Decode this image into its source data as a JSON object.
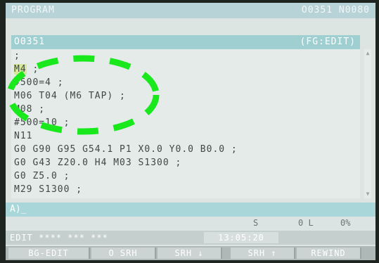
{
  "title_bar": {
    "mode": "PROGRAM",
    "program_info": "O0351 N0080"
  },
  "program_header": {
    "program_number": "O0351",
    "mode_tag": "(FG:EDIT)"
  },
  "program_lines": [
    {
      "first": ";",
      "rest": ""
    },
    {
      "first": "M4",
      "rest": " ;"
    },
    {
      "first": "#500=4",
      "rest": " ;"
    },
    {
      "first": "M06",
      "rest": " T04 (M6 TAP) ;"
    },
    {
      "first": "M08",
      "rest": " ;"
    },
    {
      "first": "#500=10",
      "rest": " ;"
    },
    {
      "first": "N11",
      "rest": ""
    },
    {
      "first": "G0",
      "rest": " G90 G95 G54.1 P1 X0.0 Y0.0 B0.0 ;"
    },
    {
      "first": "G0",
      "rest": " G43 Z20.0 H4 M03 S1300 ;"
    },
    {
      "first": "G0",
      "rest": " Z5.0 ;"
    },
    {
      "first": "M29",
      "rest": " S1300 ;"
    }
  ],
  "input_line": {
    "prompt": "A)_"
  },
  "status_values": {
    "s_label": "S",
    "l_value": "0 L",
    "percent": "0%"
  },
  "mode_bar": {
    "status": "EDIT **** *** ***",
    "time": "13:05:20"
  },
  "softkeys": [
    "BG-EDIT",
    "O SRH",
    "SRH ↓",
    "SRH ↑",
    "REWIND"
  ],
  "colors": {
    "highlight": "#d7e89a",
    "annotation": "#19e81c",
    "header": "#9fcfd0"
  }
}
